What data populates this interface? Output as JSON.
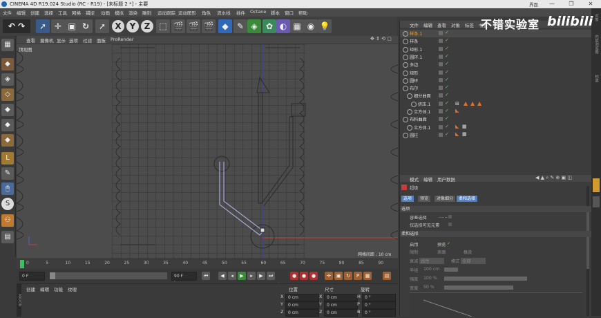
{
  "window": {
    "title": "CINEMA 4D R19.024 Studio (RC - R19) - [未标题 2 *] - 主要",
    "right_label": "界面",
    "controls": [
      "—",
      "❐",
      "✕"
    ]
  },
  "watermark": {
    "text": "不错实验室",
    "brand": "bilibili"
  },
  "menu": [
    "文件",
    "编辑",
    "创建",
    "选择",
    "工具",
    "网格",
    "捕捉",
    "动画",
    "模拟",
    "渲染",
    "雕刻",
    "运动跟踪",
    "运动图形",
    "角色",
    "流水线",
    "插件",
    "Octane",
    "脚本",
    "窗口",
    "帮助"
  ],
  "toolbar": {
    "axes": [
      "X",
      "Y",
      "Z"
    ]
  },
  "viewport": {
    "menu": [
      "查看",
      "摄像机",
      "显示",
      "选项",
      "过滤",
      "面板",
      "ProRender"
    ],
    "label": "顶视图",
    "grid_spacing": "网格间距 : 10 cm"
  },
  "timeline": {
    "ticks": [
      "0",
      "5",
      "10",
      "15",
      "20",
      "25",
      "30",
      "35",
      "40",
      "45",
      "50",
      "55",
      "60",
      "65",
      "70",
      "75",
      "80",
      "85",
      "90"
    ],
    "start_frame": "0 F",
    "current_frame": "0 F",
    "range_end": "90 F",
    "end_frame": "90 F"
  },
  "material_panel": {
    "tabs": [
      "创建",
      "编辑",
      "功能",
      "纹理"
    ]
  },
  "coord_panel": {
    "headers": [
      "位置",
      "尺寸",
      "旋转"
    ],
    "rows": [
      {
        "axis": "X",
        "pos": "0 cm",
        "size": "0 cm",
        "rot_label": "H",
        "rot": "0 °"
      },
      {
        "axis": "Y",
        "pos": "0 cm",
        "size": "0 cm",
        "rot_label": "P",
        "rot": "0 °"
      },
      {
        "axis": "Z",
        "pos": "0 cm",
        "size": "0 cm",
        "rot_label": "B",
        "rot": "0 °"
      }
    ]
  },
  "object_manager": {
    "menu": [
      "文件",
      "编辑",
      "查看",
      "对象",
      "标签",
      "书签"
    ],
    "objects": [
      {
        "name": "样条.1",
        "selected": true,
        "indent": 0,
        "tags": ""
      },
      {
        "name": "样条",
        "selected": false,
        "indent": 0,
        "tags": ""
      },
      {
        "name": "矩形.1",
        "selected": false,
        "indent": 0,
        "tags": ""
      },
      {
        "name": "圆环.1",
        "selected": false,
        "indent": 0,
        "tags": ""
      },
      {
        "name": "多边",
        "selected": false,
        "indent": 0,
        "tags": ""
      },
      {
        "name": "矩形",
        "selected": false,
        "indent": 0,
        "tags": ""
      },
      {
        "name": "圆环",
        "selected": false,
        "indent": 0,
        "tags": ""
      },
      {
        "name": "布尔",
        "selected": false,
        "indent": 0,
        "tags": ""
      },
      {
        "name": "细分曲面",
        "selected": false,
        "indent": 1,
        "tags": ""
      },
      {
        "name": "挤压.1",
        "selected": false,
        "indent": 2,
        "tags": "tri"
      },
      {
        "name": "立方体.1",
        "selected": false,
        "indent": 1,
        "tags": "tex"
      },
      {
        "name": "布料曲面",
        "selected": false,
        "indent": 0,
        "tags": ""
      },
      {
        "name": "立方体.1",
        "selected": false,
        "indent": 1,
        "tags": "chk"
      },
      {
        "name": "圆柱",
        "selected": false,
        "indent": 0,
        "tags": "chk"
      }
    ]
  },
  "attribute_manager": {
    "menu": [
      "模式",
      "编辑",
      "用户数据"
    ],
    "header": "超级",
    "tabs": [
      "选项",
      "预览",
      "对象细分",
      "柔和选择"
    ],
    "selection_section": "选项",
    "selection_rows": [
      {
        "label": "容差选择",
        "value": "……"
      },
      {
        "label": "仅选择可见元素",
        "value": ""
      }
    ],
    "soft_section": "柔和选择",
    "soft_rows": [
      {
        "label": "启用",
        "value": ""
      },
      {
        "label": "预览",
        "value": "✓"
      },
      {
        "label": "限制",
        "value": ""
      },
      {
        "label": "表面",
        "value": ""
      },
      {
        "label": "橡皮",
        "value": ""
      },
      {
        "label": "衰减",
        "value": "线性"
      },
      {
        "label": "模式",
        "value": "全部"
      },
      {
        "label": "半径",
        "value": "100 cm"
      },
      {
        "label": "强度",
        "value": "100 %"
      },
      {
        "label": "宽度",
        "value": "50 %"
      }
    ]
  },
  "colors": {
    "accent": "#2f69b8",
    "grid": "#2c2c2c",
    "spline": "#a8a8d8",
    "axis_blue": "#3a3ab0",
    "axis_red": "#c83c3c",
    "check": "#6ec96e"
  }
}
